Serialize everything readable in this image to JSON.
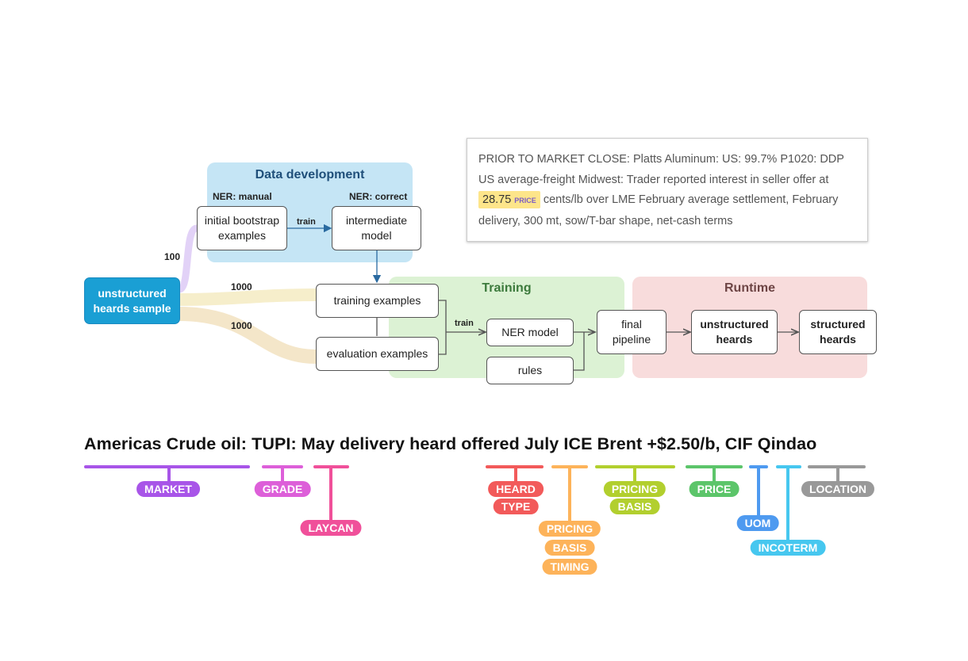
{
  "regions": {
    "data_development": {
      "title": "Data development",
      "color": "#c5e5f5",
      "title_color": "#1f4f7a"
    },
    "training": {
      "title": "Training",
      "color": "#dcf2d4",
      "title_color": "#3c7a3c"
    },
    "runtime": {
      "title": "Runtime",
      "color": "#f8dcdc",
      "title_color": "#6e4545"
    }
  },
  "labels": {
    "ner_manual": "NER: manual",
    "ner_correct": "NER: correct",
    "train_1": "train",
    "train_2": "train",
    "count_100": "100",
    "count_1000_a": "1000",
    "count_1000_b": "1000"
  },
  "nodes": {
    "source": "unstructured\nheards sample",
    "initial_bootstrap": "initial bootstrap\nexamples",
    "intermediate_model": "intermediate\nmodel",
    "training_examples": "training examples",
    "evaluation_examples": "evaluation examples",
    "ner_model": "NER model",
    "rules": "rules",
    "final_pipeline": "final\npipeline",
    "unstructured_heards": "unstructured\nheards",
    "structured_heards": "structured\nheards"
  },
  "source_color": "#1a9fd4",
  "example_quote": {
    "before": "PRIOR TO MARKET CLOSE: Platts Aluminum: US: 99.7% P1020: DDP US average-freight Midwest: Trader reported interest in seller offer at ",
    "price_value": "28.75",
    "price_tag": "PRICE",
    "after": " cents/lb over LME February average settlement, February delivery, 300 mt, sow/T-bar shape, net-cash terms"
  },
  "annotated_sentence": {
    "text": "Americas Crude oil: TUPI: May delivery heard offered July ICE Brent +$2.50/b, CIF Qindao",
    "entities": [
      {
        "label": "MARKET",
        "color": "#a855e8"
      },
      {
        "label": "GRADE",
        "color": "#dd5fd9"
      },
      {
        "label": "LAYCAN",
        "color": "#f0509a"
      },
      {
        "label": "HEARD\nTYPE",
        "color": "#f25a5a"
      },
      {
        "label": "PRICING\nBASIS\nTIMING",
        "color": "#fdb35a"
      },
      {
        "label": "PRICING\nBASIS",
        "color": "#b2cf2e"
      },
      {
        "label": "PRICE",
        "color": "#5cc56a"
      },
      {
        "label": "UOM",
        "color": "#4e9af0"
      },
      {
        "label": "INCOTERM",
        "color": "#46c7ef"
      },
      {
        "label": "LOCATION",
        "color": "#999999"
      }
    ],
    "entity_lines": {
      "market": "MARKET",
      "grade": "GRADE",
      "laycan": "LAYCAN",
      "heard_1": "HEARD",
      "heard_2": "TYPE",
      "pbt_1": "PRICING",
      "pbt_2": "BASIS",
      "pbt_3": "TIMING",
      "pb_1": "PRICING",
      "pb_2": "BASIS",
      "price": "PRICE",
      "uom": "UOM",
      "incoterm": "INCOTERM",
      "location": "LOCATION"
    }
  }
}
